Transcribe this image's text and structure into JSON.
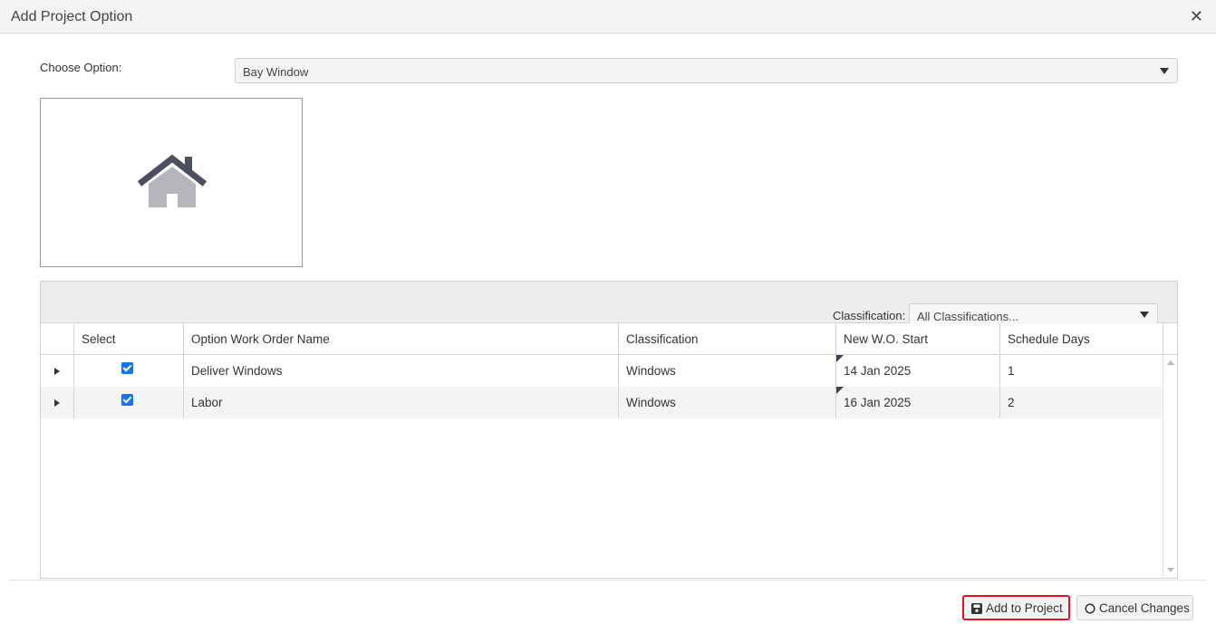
{
  "dialog": {
    "title": "Add Project Option",
    "close_label": "✕"
  },
  "option": {
    "label": "Choose Option:",
    "value": "Bay Window"
  },
  "image": {
    "icon": "house-icon"
  },
  "grid": {
    "classification_label": "Classification:",
    "classification_value": "All Classifications...",
    "columns": [
      "Select",
      "Option Work Order Name",
      "Classification",
      "New W.O. Start",
      "Schedule Days"
    ],
    "rows": [
      {
        "selected": true,
        "name": "Deliver Windows",
        "classification": "Windows",
        "start": "14 Jan 2025",
        "days": "1"
      },
      {
        "selected": true,
        "name": "Labor",
        "classification": "Windows",
        "start": "16 Jan 2025",
        "days": "2"
      }
    ]
  },
  "footer": {
    "add_label": "Add to Project",
    "cancel_label": "Cancel Changes",
    "highlight_color": "#e0141c"
  }
}
